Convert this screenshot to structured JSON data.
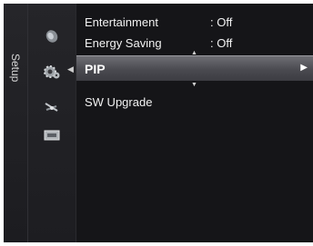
{
  "sidebar": {
    "label": "Setup"
  },
  "menu": {
    "items": [
      {
        "name": "Entertainment",
        "value": ": Off"
      },
      {
        "name": "Energy Saving",
        "value": ": Off"
      },
      {
        "name": "PIP",
        "value": ""
      },
      {
        "name": "SW Upgrade",
        "value": ""
      }
    ],
    "selected_index": 2
  },
  "icons": [
    "satellite-dish-icon",
    "gear-icon",
    "antenna-icon",
    "input-card-icon"
  ],
  "colors": {
    "background": "#151518",
    "highlight": "#5a5a60",
    "text": "#f2f2f2"
  }
}
